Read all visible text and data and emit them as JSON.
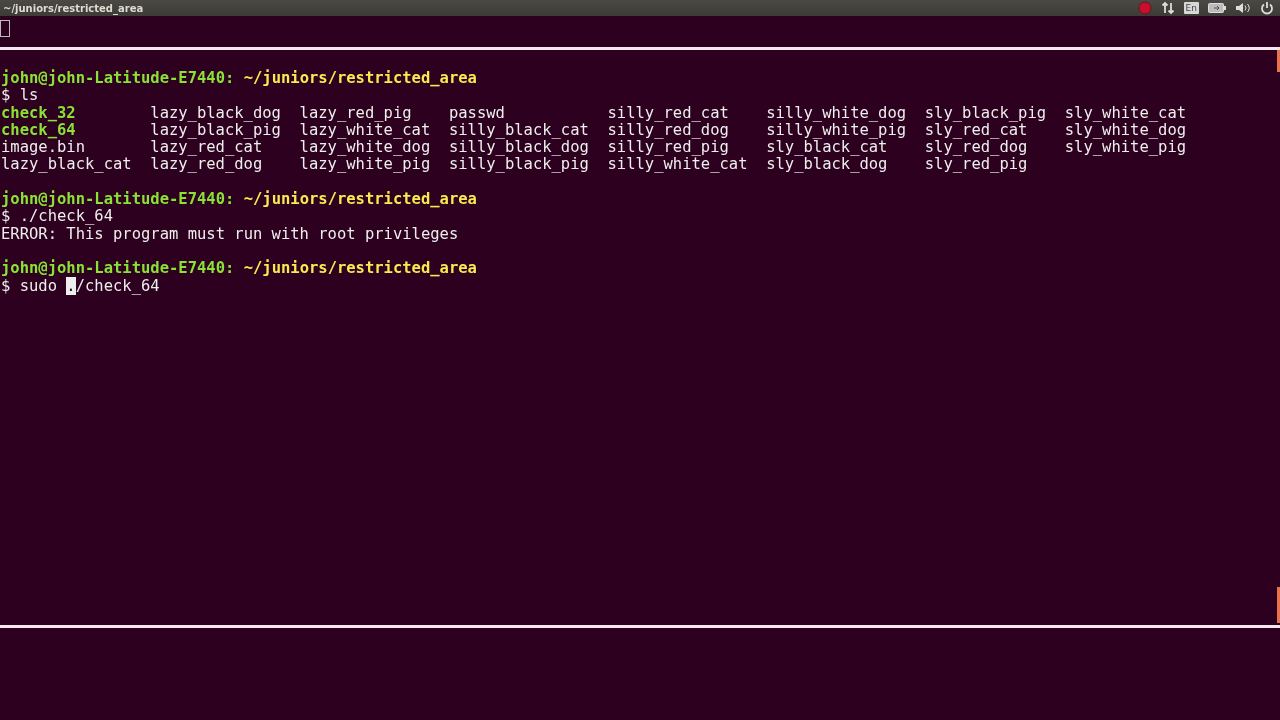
{
  "top_bar": {
    "title": "~/juniors/restricted_area",
    "keyboard_layout": "En"
  },
  "session": [
    {
      "kind": "prompt",
      "user_host": "john@john-Latitude-E7440:",
      "path": "~/juniors/restricted_area",
      "prompt_symbol": "$",
      "command": "ls"
    },
    {
      "kind": "listing",
      "columns": [
        [
          {
            "name": "check_32",
            "executable": true
          },
          {
            "name": "check_64",
            "executable": true
          },
          {
            "name": "image.bin",
            "executable": false
          },
          {
            "name": "lazy_black_cat",
            "executable": false
          }
        ],
        [
          {
            "name": "lazy_black_dog",
            "executable": false
          },
          {
            "name": "lazy_black_pig",
            "executable": false
          },
          {
            "name": "lazy_red_cat",
            "executable": false
          },
          {
            "name": "lazy_red_dog",
            "executable": false
          }
        ],
        [
          {
            "name": "lazy_red_pig",
            "executable": false
          },
          {
            "name": "lazy_white_cat",
            "executable": false
          },
          {
            "name": "lazy_white_dog",
            "executable": false
          },
          {
            "name": "lazy_white_pig",
            "executable": false
          }
        ],
        [
          {
            "name": "passwd",
            "executable": false
          },
          {
            "name": "silly_black_cat",
            "executable": false
          },
          {
            "name": "silly_black_dog",
            "executable": false
          },
          {
            "name": "silly_black_pig",
            "executable": false
          }
        ],
        [
          {
            "name": "silly_red_cat",
            "executable": false
          },
          {
            "name": "silly_red_dog",
            "executable": false
          },
          {
            "name": "silly_red_pig",
            "executable": false
          },
          {
            "name": "silly_white_cat",
            "executable": false
          }
        ],
        [
          {
            "name": "silly_white_dog",
            "executable": false
          },
          {
            "name": "silly_white_pig",
            "executable": false
          },
          {
            "name": "sly_black_cat",
            "executable": false
          },
          {
            "name": "sly_black_dog",
            "executable": false
          }
        ],
        [
          {
            "name": "sly_black_pig",
            "executable": false
          },
          {
            "name": "sly_red_cat",
            "executable": false
          },
          {
            "name": "sly_red_dog",
            "executable": false
          },
          {
            "name": "sly_red_pig",
            "executable": false
          }
        ],
        [
          {
            "name": "sly_white_cat",
            "executable": false
          },
          {
            "name": "sly_white_dog",
            "executable": false
          },
          {
            "name": "sly_white_pig",
            "executable": false
          }
        ]
      ]
    },
    {
      "kind": "prompt",
      "user_host": "john@john-Latitude-E7440:",
      "path": "~/juniors/restricted_area",
      "prompt_symbol": "$",
      "command": "./check_64"
    },
    {
      "kind": "output",
      "text": "ERROR: This program must run with root privileges"
    },
    {
      "kind": "prompt",
      "user_host": "john@john-Latitude-E7440:",
      "path": "~/juniors/restricted_area",
      "prompt_symbol": "$",
      "command": "sudo ",
      "cursor_char": ".",
      "command_rest": "/check_64"
    }
  ]
}
